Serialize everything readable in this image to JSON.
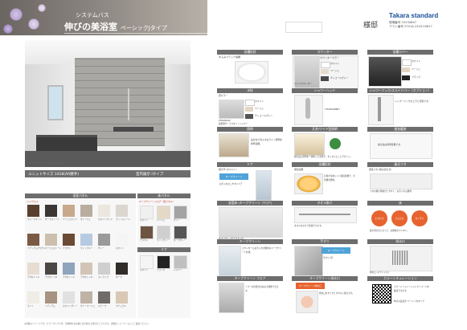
{
  "header": {
    "series_label": "システムバス",
    "title": "伸びの美浴室",
    "type": "ベーシックJタイプ"
  },
  "customer": {
    "honorific": "様邸"
  },
  "brand": {
    "name": "Takara standard",
    "management_label": "現場番号",
    "management_no": "C0234847",
    "plan_label": "プラン番号",
    "plan_no": "2701A-2203-03817"
  },
  "room": {
    "caption": "※写真は一部オプション品を含みます。",
    "size_label": "ユニットサイズ 1418(AR勝手)",
    "wall_label": "室内展示 Iタイプ"
  },
  "sections": {
    "wall_panel": "浴室パネル",
    "floor": "床パネル",
    "door": "ドア",
    "bathtub": "浴槽形状",
    "counter": "カウンター",
    "bath_cover": "浴槽カバー",
    "faucet": "水栓",
    "shower": "シャワーヘッド",
    "shower_sub": "シャワーフック/スライドバー（オプション）",
    "lighting": "照明",
    "ceiling": "天井/ワイド型照明",
    "ventilation": "換気暖房",
    "door_type": "ドア",
    "lid": "風呂フタ",
    "floor_type": "床",
    "drain": "排水口",
    "towel": "タオル掛け",
    "handrail": "手すり",
    "cleaning": "キープクリーン",
    "color_sim": "カラーシミュレーション",
    "options": "その他オプション"
  },
  "panels": {
    "bathtub_name": "まるみステップ浴槽",
    "counter_name": "カウンターカラー",
    "counter_colors": [
      "ホワイト",
      "ベージュ",
      "チャコールグレー"
    ],
    "cover_colors": [
      "ホワイト",
      "ベージュ",
      "ブラック"
    ],
    "faucet_name": "浴槽水栓",
    "faucet_note": "ワイドカウンター",
    "floor_name": "床カラー",
    "floor_colors": [
      "ホワイト",
      "ベージュ",
      "チャコールグレー"
    ],
    "faucet_model": "KF620BLSP",
    "faucet_model_name": "最低限サーモスタットシャワー",
    "shower_model": "TH2E0SBMH",
    "shower_note": "シャワーフックの上下に可能です。",
    "lighting_note": "LED照明",
    "lighting_desc": "長寿命で省エネなライト照明を標準装備。",
    "ceiling_desc": "換気扇と照明を一体化した天井で、すっきりとしたデザイン。",
    "vent_desc": "換気扇は標準装備です。",
    "door_name": "開き戸 (ホワイト)",
    "door_badge": "キープクリーン",
    "door_desc": "お手入れのしやすいドア",
    "lid_name": "風呂フタ (組み合わせ)",
    "lid_desc": "フタの開け閉めがしやすく、お手入れも簡単。",
    "tub_desc": "お湯が冷めにくい保温浴槽で、光熱費を節約。",
    "tub_name": "保温浴槽",
    "floor_name2": "浴室床 (キープクリーン フロア)",
    "floor_desc": "水はけがよく乾きやすい床。",
    "floor_features": [
      "ピカピカ",
      "さらさら",
      "ガッチリ"
    ],
    "drain_name": "排水口 (ステンレス)",
    "drain_desc": "髪の毛がまとまって、お掃除がカンタン。",
    "towel_name": "タオル掛け",
    "towel_desc": "タオルをかけて乾燥できます。",
    "handrail_name": "手すり I型",
    "clean_desc": "キープクリーン フロア",
    "counter_badge": "キープクリーン",
    "counter_desc": "カウンターもお手入れが簡単なキープクリーン仕様。",
    "drain_badge": "キープクリーン排水口",
    "drain_desc2": "排水口をすっきりきれいに保ちます。",
    "mirror_desc": "ミラーの位置がお好みで調整できます。",
    "sim_desc": "カラーシミュレーションでイメージを確認できます。",
    "sim_name": "伸びの美浴室 ベーシックJタイプ"
  },
  "wall_swatches": {
    "heading": "ハイグロス",
    "items": [
      {
        "label": "ウォールナット",
        "color": "#5a3f2e"
      },
      {
        "label": "ダークストーン",
        "color": "#3b3734"
      },
      {
        "label": "ベージュウッド",
        "color": "#c8a98c"
      },
      {
        "label": "グレージュ",
        "color": "#b9ada0"
      },
      {
        "label": "ホワイトウッド",
        "color": "#ece7de"
      },
      {
        "label": "ライトストーン",
        "color": "#dbd6cf"
      },
      {
        "label": "ミディアムブラウン",
        "color": "#7a5a44"
      },
      {
        "label": "ベージュストーン",
        "color": "#cdbfae"
      },
      {
        "label": "ブラウン",
        "color": "#6b4a36"
      },
      {
        "label": "ライトブルー",
        "color": "#b7cbe0"
      },
      {
        "label": "グレー",
        "color": "#9a9a9a"
      },
      {
        "label": "ホワイト",
        "color": "#f5f5f5"
      },
      {
        "label": "アクセントA",
        "color": "#e7ddd2"
      },
      {
        "label": "アクセントB",
        "color": "#4a4745"
      },
      {
        "label": "アクセントC",
        "color": "#8fa4bd"
      },
      {
        "label": "アクセントD",
        "color": "#d2c5b7"
      },
      {
        "label": "ストライプ",
        "color": "#cfcfcf"
      },
      {
        "label": "ダーク",
        "color": "#2f2c2a"
      },
      {
        "label": "ライト",
        "color": "#f0ece6"
      },
      {
        "label": "ミディアム",
        "color": "#a79380"
      },
      {
        "label": "ホワイトグレー",
        "color": "#e1e1e1"
      },
      {
        "label": "グレーベージュ",
        "color": "#bfb3a6"
      },
      {
        "label": "スモーク",
        "color": "#6f6c69"
      },
      {
        "label": "ナチュラル",
        "color": "#d9c8b4"
      }
    ]
  },
  "floor_swatches": {
    "heading": "キープクリーンフロア（床パネル）",
    "items": [
      {
        "label": "ホワイト",
        "color": "#f0f0f0"
      },
      {
        "label": "ベージュ",
        "color": "#e5d9c6"
      },
      {
        "label": "グレー",
        "color": "#a3a3a3"
      },
      {
        "label": "ブラウン",
        "color": "#6e5442"
      },
      {
        "label": "ライトグレー",
        "color": "#cfcfcf"
      },
      {
        "label": "ダークグレー",
        "color": "#555555"
      }
    ],
    "door_heading": "ドア",
    "door_items": [
      {
        "label": "ホワイト",
        "color": "#f5f5f5"
      },
      {
        "label": "ブラック",
        "color": "#222222"
      },
      {
        "label": "シルバー",
        "color": "#c0c0c0"
      }
    ]
  },
  "footer": {
    "note": "※画像はイメージです。カラーサンプル等、印刷物の為実物と色が異なる場合がございます。詳細はショールームにてご確認ください。"
  }
}
